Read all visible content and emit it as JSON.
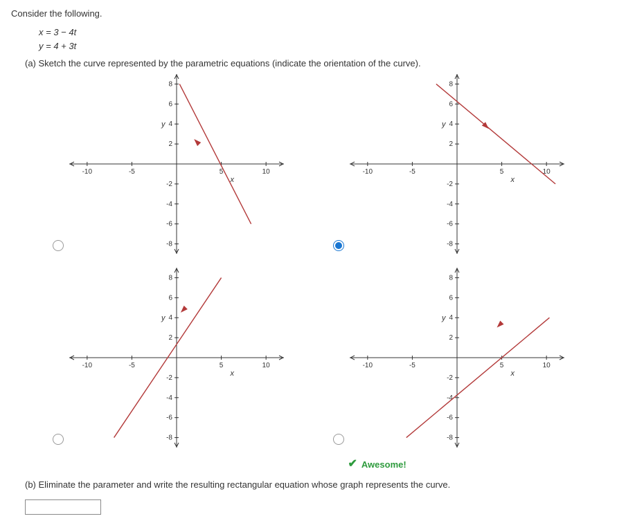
{
  "prompt": "Consider the following.",
  "equations": {
    "line1": "x = 3 − 4t",
    "line2": "y = 4 + 3t"
  },
  "part_a": "(a) Sketch the curve represented by the parametric equations (indicate the orientation of the curve).",
  "part_b": "(b) Eliminate the parameter and write the resulting rectangular equation whose graph represents the curve.",
  "feedback": "Awesome!",
  "selected_index": 1,
  "answer_value": "",
  "axis": {
    "x_ticks": [
      -10,
      -5,
      5,
      10
    ],
    "y_ticks": [
      -8,
      -6,
      -4,
      -2,
      2,
      4,
      6,
      8
    ],
    "x_label": "x",
    "y_label": "y"
  },
  "chart_data": [
    {
      "type": "line",
      "id": "option-a",
      "xlim": [
        -12,
        12
      ],
      "ylim": [
        -9,
        9
      ],
      "line": {
        "x1": 0.33,
        "y1": 8,
        "x2": 8.33,
        "y2": -6
      },
      "arrow_at": {
        "x": 2.5,
        "y": 2,
        "dir": "up-left"
      }
    },
    {
      "type": "line",
      "id": "option-b",
      "xlim": [
        -12,
        12
      ],
      "ylim": [
        -9,
        9
      ],
      "line": {
        "x1": -2.33,
        "y1": 8,
        "x2": 11,
        "y2": -2
      },
      "arrow_at": {
        "x": 3,
        "y": 4,
        "dir": "down-right"
      }
    },
    {
      "type": "line",
      "id": "option-c",
      "xlim": [
        -12,
        12
      ],
      "ylim": [
        -9,
        9
      ],
      "line": {
        "x1": -7,
        "y1": -8,
        "x2": 5,
        "y2": 8
      },
      "arrow_at": {
        "x": 1,
        "y": 5,
        "dir": "down-left"
      }
    },
    {
      "type": "line",
      "id": "option-d",
      "xlim": [
        -12,
        12
      ],
      "ylim": [
        -9,
        9
      ],
      "line": {
        "x1": -5.67,
        "y1": -8,
        "x2": 10.33,
        "y2": 4
      },
      "arrow_at": {
        "x": 5,
        "y": 3.5,
        "dir": "down-left"
      }
    }
  ]
}
